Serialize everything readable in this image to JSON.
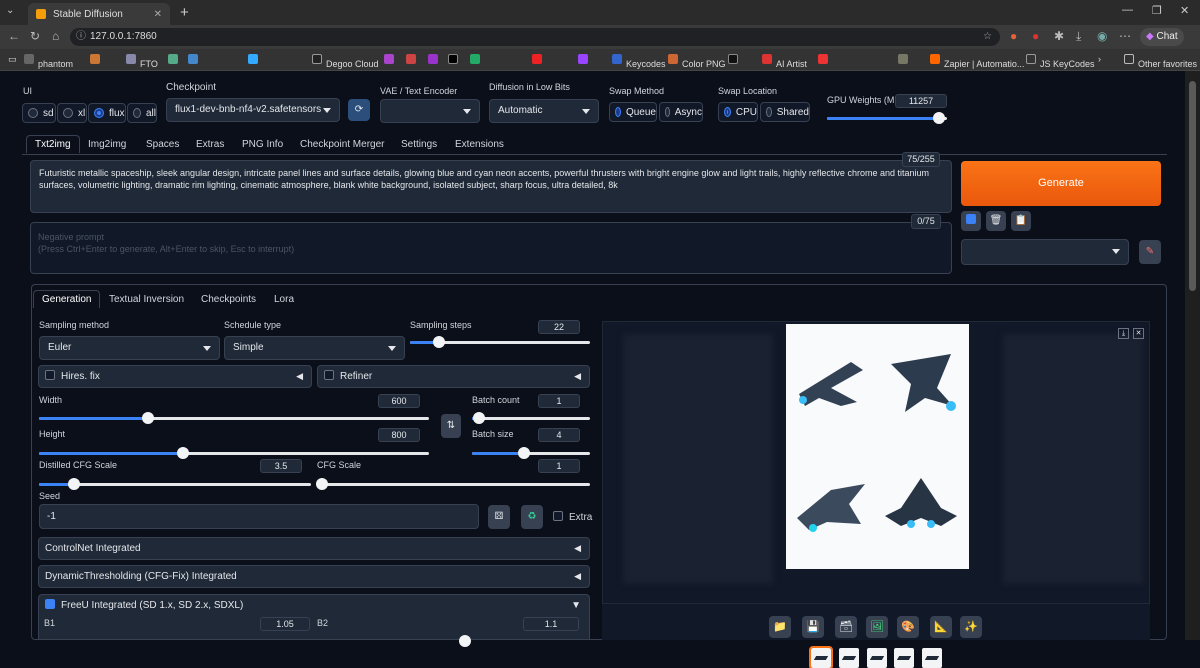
{
  "browser": {
    "tab_title": "Stable Diffusion",
    "url": "127.0.0.1:7860",
    "chat_label": "Chat",
    "bookmarks": [
      "phantom",
      "FTO",
      "Degoo Cloud",
      "Keycodes",
      "Color PNG",
      "AI Artist",
      "Zapier | Automatio...",
      "JS KeyCodes",
      "Other favorites"
    ]
  },
  "ui_mode": {
    "label": "UI",
    "options": [
      "sd",
      "xl",
      "flux",
      "all"
    ],
    "selected": "flux"
  },
  "checkpoint": {
    "label": "Checkpoint",
    "value": "flux1-dev-bnb-nf4-v2.safetensors"
  },
  "vae": {
    "label": "VAE / Text Encoder",
    "value": ""
  },
  "diffusion_low_bits": {
    "label": "Diffusion in Low Bits",
    "value": "Automatic"
  },
  "swap_method": {
    "label": "Swap Method",
    "options": [
      "Queue",
      "Async"
    ],
    "selected": "Queue"
  },
  "swap_location": {
    "label": "Swap Location",
    "options": [
      "CPU",
      "Shared"
    ],
    "selected": "CPU"
  },
  "gpu_weights": {
    "label": "GPU Weights (MB)",
    "value": "11257",
    "fraction": 0.93
  },
  "main_tabs": [
    "Txt2img",
    "Img2img",
    "Spaces",
    "Extras",
    "PNG Info",
    "Checkpoint Merger",
    "Settings",
    "Extensions"
  ],
  "prompt": {
    "text": "Futuristic metallic spaceship, sleek angular design, intricate panel lines and surface details, glowing blue and cyan neon accents, powerful thrusters with bright engine glow and light trails, highly reflective chrome and titanium surfaces, volumetric lighting, dramatic rim lighting, cinematic atmosphere, blank white background, isolated subject, sharp focus, ultra detailed, 8k",
    "token_count": "75/255"
  },
  "negative_prompt": {
    "placeholder": "Negative prompt\n(Press Ctrl+Enter to generate, Alt+Enter to skip, Esc to interrupt)",
    "token_count": "0/75"
  },
  "generate_label": "Generate",
  "sub_tabs": [
    "Generation",
    "Textual Inversion",
    "Checkpoints",
    "Lora"
  ],
  "sampling_method": {
    "label": "Sampling method",
    "value": "Euler"
  },
  "schedule_type": {
    "label": "Schedule type",
    "value": "Simple"
  },
  "sampling_steps": {
    "label": "Sampling steps",
    "value": "22"
  },
  "hires_fix": {
    "label": "Hires. fix"
  },
  "refiner": {
    "label": "Refiner"
  },
  "width": {
    "label": "Width",
    "value": "600"
  },
  "height": {
    "label": "Height",
    "value": "800"
  },
  "batch_count": {
    "label": "Batch count",
    "value": "1"
  },
  "batch_size": {
    "label": "Batch size",
    "value": "4"
  },
  "distilled_cfg": {
    "label": "Distilled CFG Scale",
    "value": "3.5"
  },
  "cfg_scale": {
    "label": "CFG Scale",
    "value": "1"
  },
  "seed": {
    "label": "Seed",
    "value": "-1",
    "extra_label": "Extra"
  },
  "accordions": {
    "controlnet": "ControlNet Integrated",
    "dynthres": "DynamicThresholding (CFG-Fix) Integrated",
    "freeu": "FreeU Integrated (SD 1.x, SD 2.x, SDXL)"
  },
  "freeu": {
    "b1_label": "B1",
    "b1_value": "1.05",
    "b2_label": "B2",
    "b2_value": "1.1"
  }
}
